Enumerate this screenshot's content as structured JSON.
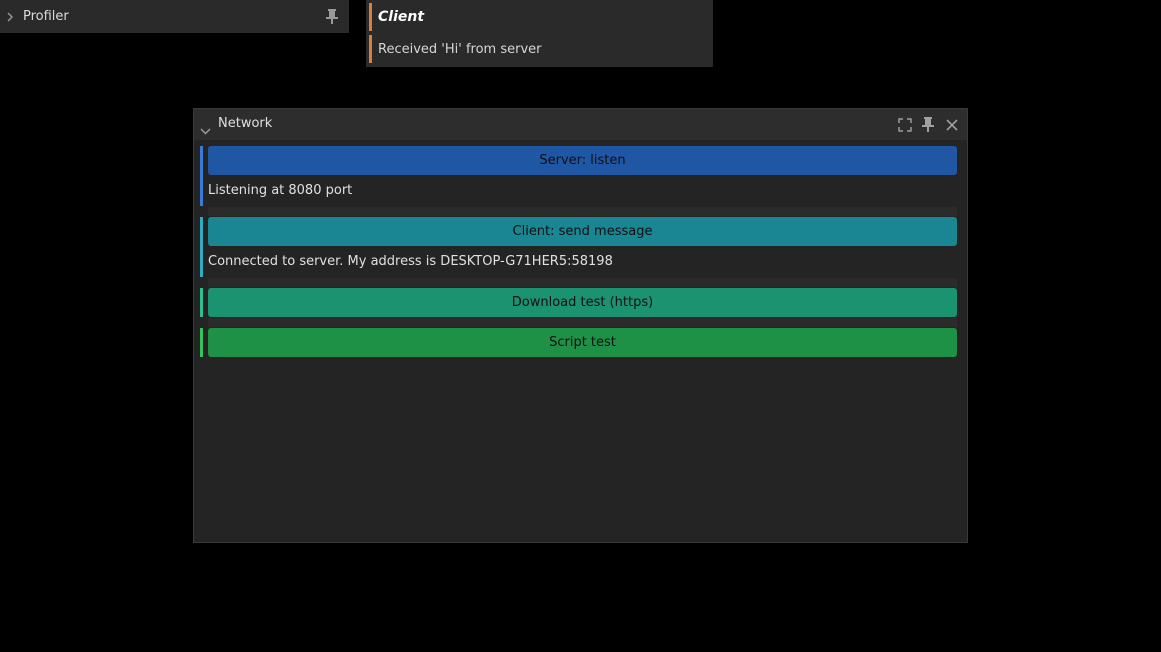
{
  "profiler": {
    "title": "Profiler",
    "icons": {
      "expand": "chevron-right-icon",
      "pin": "pin-icon"
    }
  },
  "toast": {
    "title": "Client",
    "message": "Received 'Hi' from server",
    "accent_color": "#d9803f"
  },
  "network": {
    "title": "Network",
    "icons": {
      "collapse": "chevron-down-icon",
      "maximize": "maximize-icon",
      "pin": "pin-icon",
      "close": "close-icon"
    },
    "sections": [
      {
        "button_label": "Server: listen",
        "button_color": "#1f57a5",
        "bar_color": "#3a7bd5",
        "status": "Listening at 8080 port"
      },
      {
        "button_label": "Client: send message",
        "button_color": "#1a8593",
        "bar_color": "#2ab0c0",
        "status": "Connected to server. My address is DESKTOP-G71HER5:58198"
      },
      {
        "button_label": "Download test (https)",
        "button_color": "#1b9270",
        "bar_color": "#2cc08f"
      },
      {
        "button_label": "Script test",
        "button_color": "#1e9147",
        "bar_color": "#34c35f"
      }
    ]
  }
}
